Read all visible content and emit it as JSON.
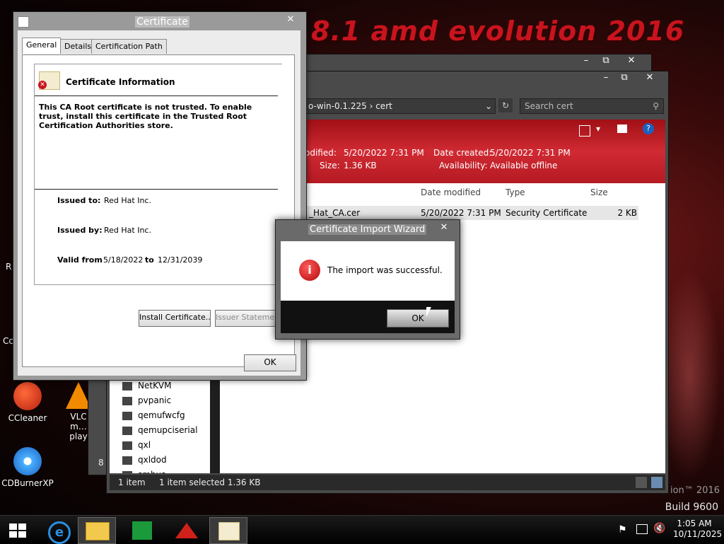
{
  "wallpaper": {
    "title": "8.1 amd evolution 2016",
    "brand": "ion™ 2016",
    "build": "Build 9600"
  },
  "desktop_icons": [
    {
      "name": "ccleaner",
      "label": "CCleaner"
    },
    {
      "name": "vlc",
      "label": "VLC m… play"
    },
    {
      "name": "cdburnerxp",
      "label": "CDBurnerXP"
    }
  ],
  "desktop_clipped": {
    "left1": "R",
    "left2": "Cc",
    "back_win": "8"
  },
  "explorer": {
    "address_path": "o-win-0.1.225  ›  cert",
    "search_placeholder": "Search cert",
    "details": {
      "modified_label": "odified:",
      "modified_value": "5/20/2022 7:31 PM",
      "size_label": "Size:",
      "size_value": "1.36 KB",
      "created_label": "Date created:",
      "created_value": "5/20/2022 7:31 PM",
      "availability_label": "Availability:",
      "availability_value": "Available offline"
    },
    "columns": {
      "date": "Date modified",
      "type": "Type",
      "size": "Size"
    },
    "file": {
      "name": "_Hat_CA.cer",
      "date": "5/20/2022 7:31 PM",
      "type": "Security Certificate",
      "size": "2 KB"
    },
    "nav_items": [
      "NetKVM",
      "pvpanic",
      "qemufwcfg",
      "qemupciserial",
      "qxl",
      "qxldod",
      "smbus"
    ],
    "status": {
      "count": "1 item",
      "selected": "1 item selected  1.36 KB"
    }
  },
  "certificate": {
    "title": "Certificate",
    "tabs": [
      "General",
      "Details",
      "Certification Path"
    ],
    "info_heading": "Certificate Information",
    "warning": "This CA Root certificate is not trusted. To enable trust, install this certificate in the Trusted Root Certification Authorities store.",
    "issued_to_label": "Issued to:",
    "issued_to": "Red Hat Inc.",
    "issued_by_label": "Issued by:",
    "issued_by": "Red Hat Inc.",
    "valid_from_label": "Valid from",
    "valid_from": "5/18/2022",
    "valid_to_label": "to",
    "valid_to": "12/31/2039",
    "install_button": "Install Certificate...",
    "issuer_button": "Issuer Statement",
    "ok_button": "OK"
  },
  "wizard": {
    "title": "Certificate Import Wizard",
    "message": "The import was successful.",
    "ok_button": "OK"
  },
  "tray": {
    "time": "1:05 AM",
    "date": "10/11/2025"
  },
  "colors": {
    "accent": "#c8141e",
    "explorer_header": "#c0202a"
  }
}
